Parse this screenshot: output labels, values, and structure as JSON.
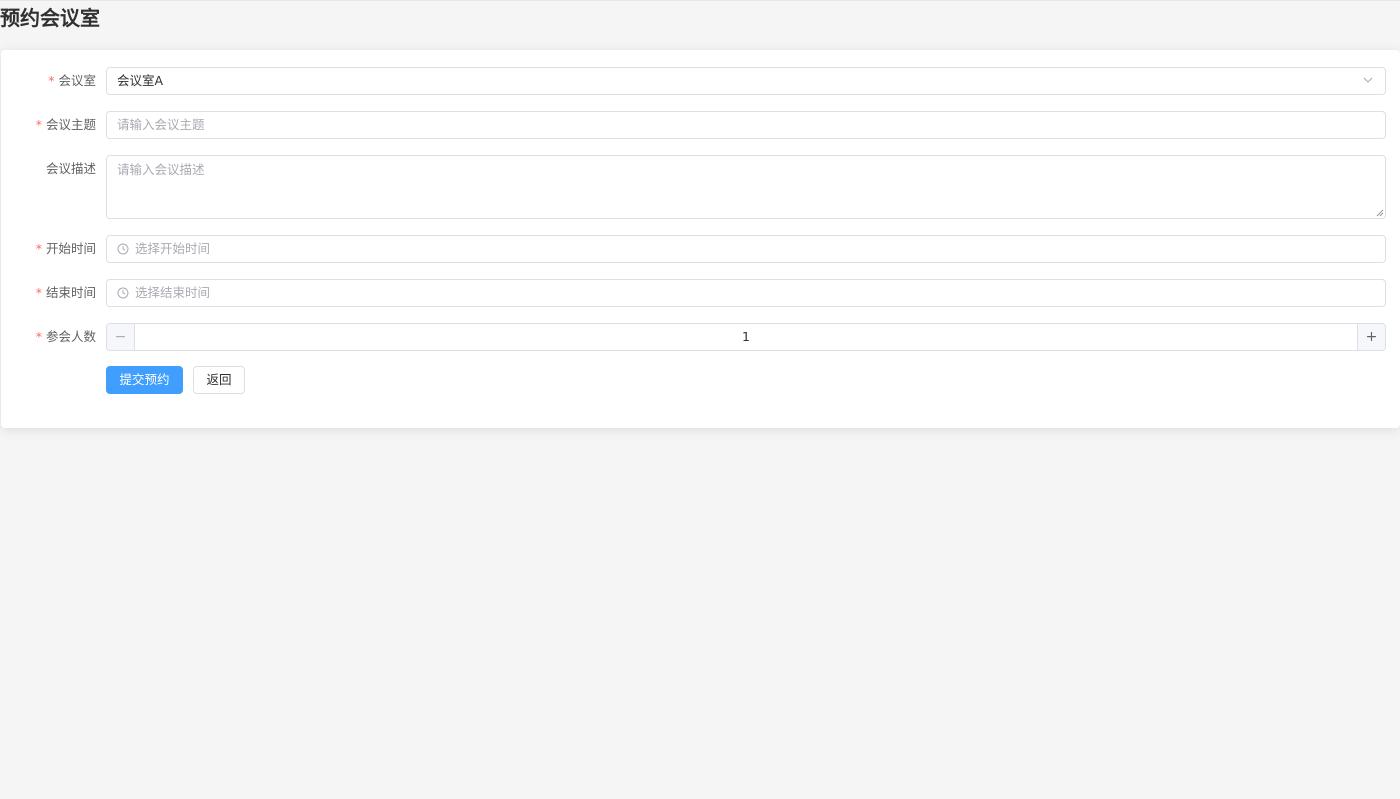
{
  "page": {
    "title": "预约会议室"
  },
  "form": {
    "room": {
      "label": "会议室",
      "required": "*",
      "value": "会议室A"
    },
    "subject": {
      "label": "会议主题",
      "required": "*",
      "placeholder": "请输入会议主题"
    },
    "description": {
      "label": "会议描述",
      "placeholder": "请输入会议描述"
    },
    "start_time": {
      "label": "开始时间",
      "required": "*",
      "placeholder": "选择开始时间"
    },
    "end_time": {
      "label": "结束时间",
      "required": "*",
      "placeholder": "选择结束时间"
    },
    "attendees": {
      "label": "参会人数",
      "required": "*",
      "value": "1",
      "minus": "−",
      "plus": "+"
    }
  },
  "actions": {
    "submit_label": "提交预约",
    "back_label": "返回"
  },
  "colors": {
    "primary": "#409eff",
    "required": "#f56c6c",
    "border": "#dcdfe6",
    "placeholder": "#a8abb2"
  },
  "icons": {
    "select_arrow": "chevron-down-icon",
    "time": "clock-icon"
  }
}
